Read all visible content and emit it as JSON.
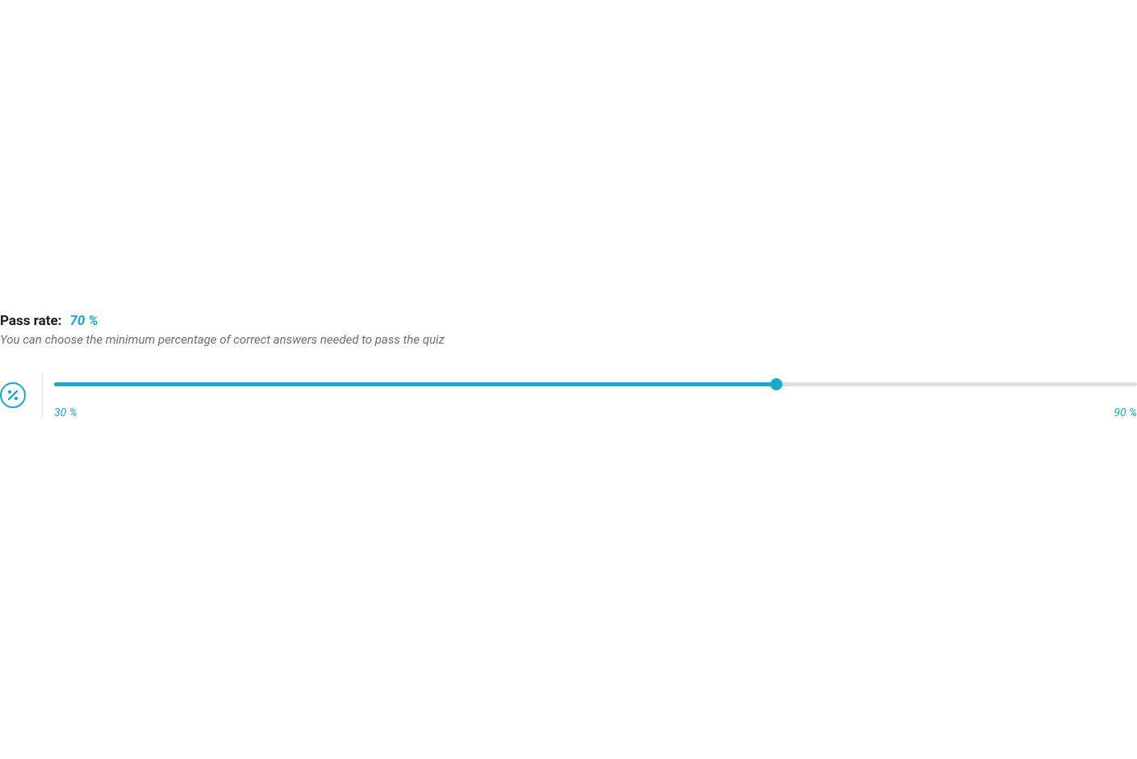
{
  "passRate": {
    "label": "Pass rate:",
    "value": "70 %",
    "description": "You can choose the minimum percentage of correct answers needed to pass the quiz",
    "slider": {
      "min": 30,
      "max": 90,
      "current": 70,
      "minLabel": "30 %",
      "maxLabel": "90 %"
    }
  },
  "colors": {
    "accent": "#1ca9c9",
    "textMuted": "#6d6d6d",
    "trackBg": "#e0e0e0"
  }
}
